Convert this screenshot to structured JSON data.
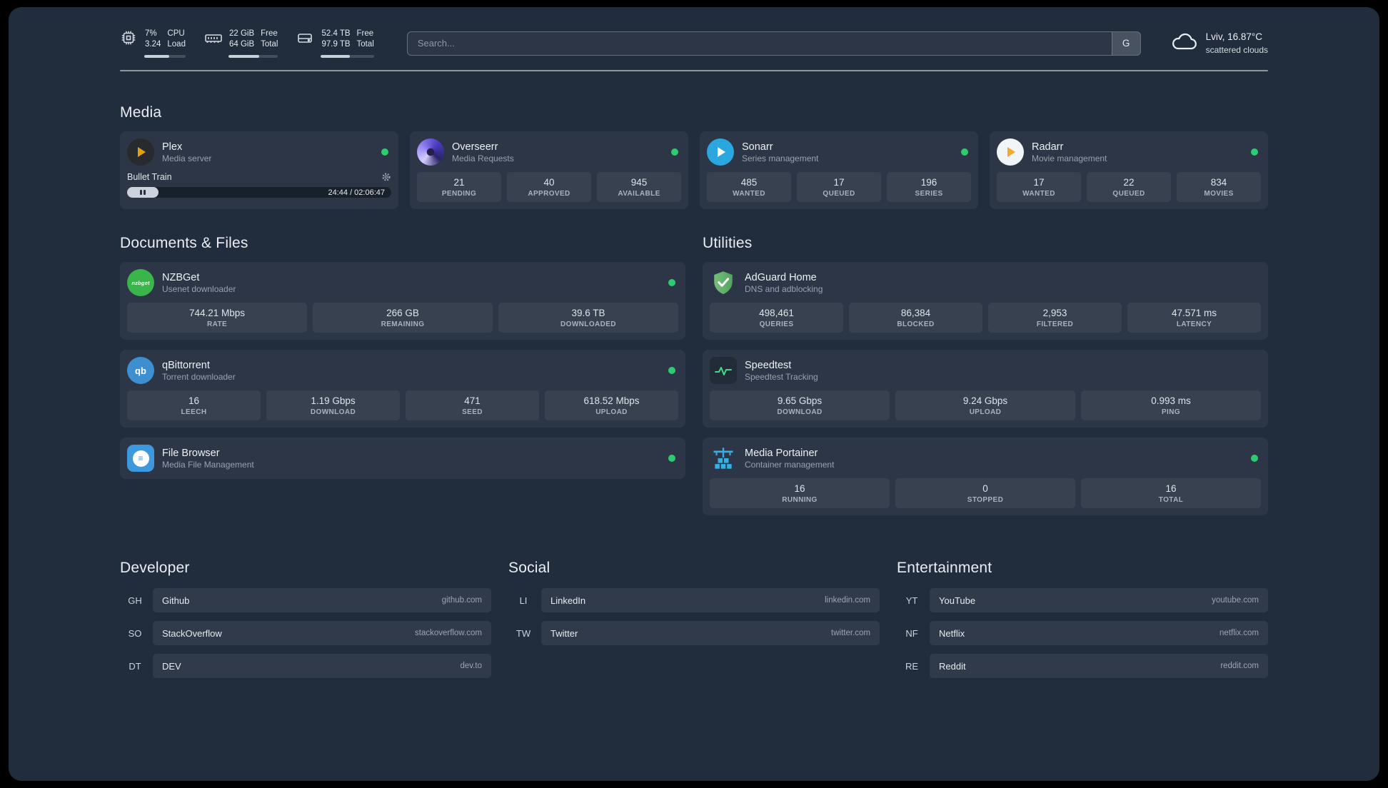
{
  "header": {
    "metrics": [
      {
        "values": [
          "7%",
          "3.24"
        ],
        "labels": [
          "CPU",
          "Load"
        ],
        "progress": 60
      },
      {
        "values": [
          "22 GiB",
          "64 GiB"
        ],
        "labels": [
          "Free",
          "Total"
        ],
        "progress": 62
      },
      {
        "values": [
          "52.4 TB",
          "97.9 TB"
        ],
        "labels": [
          "Free",
          "Total"
        ],
        "progress": 55
      }
    ],
    "search": {
      "placeholder": "Search...",
      "button": "G"
    },
    "weather": {
      "line1": "Lviv, 16.87°C",
      "line2": "scattered clouds"
    }
  },
  "sections": {
    "media": {
      "title": "Media"
    },
    "documents": {
      "title": "Documents & Files"
    },
    "utilities": {
      "title": "Utilities"
    }
  },
  "services": {
    "plex": {
      "name": "Plex",
      "desc": "Media server",
      "player": {
        "title": "Bullet Train",
        "time": "24:44 / 02:06:47",
        "progress": 12
      }
    },
    "overseerr": {
      "name": "Overseerr",
      "desc": "Media Requests",
      "stats": [
        {
          "v": "21",
          "l": "PENDING"
        },
        {
          "v": "40",
          "l": "APPROVED"
        },
        {
          "v": "945",
          "l": "AVAILABLE"
        }
      ]
    },
    "sonarr": {
      "name": "Sonarr",
      "desc": "Series management",
      "stats": [
        {
          "v": "485",
          "l": "WANTED"
        },
        {
          "v": "17",
          "l": "QUEUED"
        },
        {
          "v": "196",
          "l": "SERIES"
        }
      ]
    },
    "radarr": {
      "name": "Radarr",
      "desc": "Movie management",
      "stats": [
        {
          "v": "17",
          "l": "WANTED"
        },
        {
          "v": "22",
          "l": "QUEUED"
        },
        {
          "v": "834",
          "l": "MOVIES"
        }
      ]
    },
    "nzbget": {
      "name": "NZBGet",
      "desc": "Usenet downloader",
      "stats": [
        {
          "v": "744.21 Mbps",
          "l": "RATE"
        },
        {
          "v": "266 GB",
          "l": "REMAINING"
        },
        {
          "v": "39.6 TB",
          "l": "DOWNLOADED"
        }
      ]
    },
    "qbittorrent": {
      "name": "qBittorrent",
      "desc": "Torrent downloader",
      "stats": [
        {
          "v": "16",
          "l": "LEECH"
        },
        {
          "v": "1.19 Gbps",
          "l": "DOWNLOAD"
        },
        {
          "v": "471",
          "l": "SEED"
        },
        {
          "v": "618.52 Mbps",
          "l": "UPLOAD"
        }
      ]
    },
    "filebrowser": {
      "name": "File Browser",
      "desc": "Media File Management"
    },
    "adguard": {
      "name": "AdGuard Home",
      "desc": "DNS and adblocking",
      "stats": [
        {
          "v": "498,461",
          "l": "QUERIES"
        },
        {
          "v": "86,384",
          "l": "BLOCKED"
        },
        {
          "v": "2,953",
          "l": "FILTERED"
        },
        {
          "v": "47.571 ms",
          "l": "LATENCY"
        }
      ]
    },
    "speedtest": {
      "name": "Speedtest",
      "desc": "Speedtest Tracking",
      "stats": [
        {
          "v": "9.65 Gbps",
          "l": "DOWNLOAD"
        },
        {
          "v": "9.24 Gbps",
          "l": "UPLOAD"
        },
        {
          "v": "0.993 ms",
          "l": "PING"
        }
      ]
    },
    "portainer": {
      "name": "Media Portainer",
      "desc": "Container management",
      "stats": [
        {
          "v": "16",
          "l": "RUNNING"
        },
        {
          "v": "0",
          "l": "STOPPED"
        },
        {
          "v": "16",
          "l": "TOTAL"
        }
      ]
    }
  },
  "icon_text": {
    "qb": "qb",
    "nzbget": "nzbget",
    "filebrowser": "≡"
  },
  "bookmarks": {
    "developer": {
      "title": "Developer",
      "items": [
        {
          "abbr": "GH",
          "name": "Github",
          "url": "github.com"
        },
        {
          "abbr": "SO",
          "name": "StackOverflow",
          "url": "stackoverflow.com"
        },
        {
          "abbr": "DT",
          "name": "DEV",
          "url": "dev.to"
        }
      ]
    },
    "social": {
      "title": "Social",
      "items": [
        {
          "abbr": "LI",
          "name": "LinkedIn",
          "url": "linkedin.com"
        },
        {
          "abbr": "TW",
          "name": "Twitter",
          "url": "twitter.com"
        }
      ]
    },
    "entertainment": {
      "title": "Entertainment",
      "items": [
        {
          "abbr": "YT",
          "name": "YouTube",
          "url": "youtube.com"
        },
        {
          "abbr": "NF",
          "name": "Netflix",
          "url": "netflix.com"
        },
        {
          "abbr": "RE",
          "name": "Reddit",
          "url": "reddit.com"
        }
      ]
    }
  },
  "colors": {
    "online": "#2ecc71",
    "background": "#212c3d"
  }
}
